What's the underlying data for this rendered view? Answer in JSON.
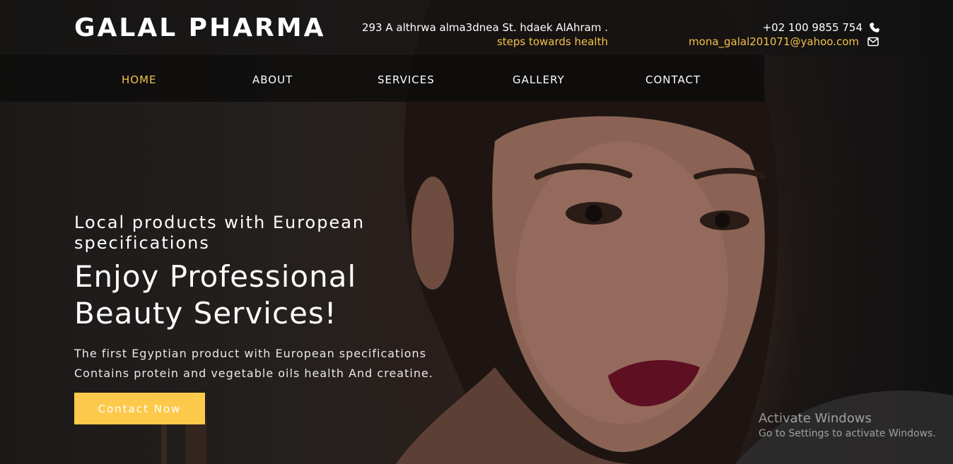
{
  "header": {
    "brand": "GALAL PHARMA",
    "address": "293 A althrwa alma3dnea St. hdaek AlAhram .",
    "tagline": "steps towards health",
    "phone": "+02 100 9855 754",
    "email": "mona_galal201071@yahoo.com"
  },
  "nav": {
    "items": [
      "HOME",
      "ABOUT",
      "SERVICES",
      "GALLERY",
      "CONTACT"
    ],
    "active": "HOME"
  },
  "hero": {
    "subtitle": "Local products with European specifications",
    "title_line1": "Enjoy Professional",
    "title_line2": "Beauty Services!",
    "desc_line1": "The first Egyptian product with European specifications",
    "desc_line2": "Contains protein and vegetable oils health And creatine.",
    "cta_label": "Contact Now"
  },
  "watermark": {
    "title": "Activate Windows",
    "subtitle": "Go to Settings to activate Windows."
  },
  "colors": {
    "accent": "#f3c14a",
    "button": "#fcc94b"
  },
  "icons": {
    "phone": "phone-icon",
    "email": "envelope-icon"
  }
}
